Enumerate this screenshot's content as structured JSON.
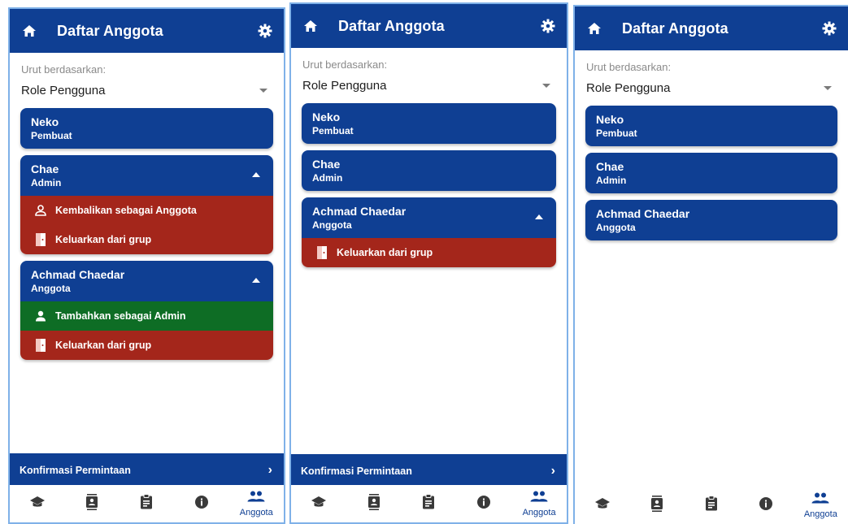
{
  "colors": {
    "primary": "#0f3f93",
    "danger": "#a4261b",
    "success": "#0e6d25"
  },
  "appbar": {
    "title": "Daftar Anggota",
    "home_icon": "home-icon",
    "settings_icon": "gear-icon"
  },
  "sort": {
    "label": "Urut berdasarkan:",
    "value": "Role Pengguna"
  },
  "actions": {
    "demote": "Kembalikan sebagai Anggota",
    "promote": "Tambahkan sebagai Admin",
    "kick": "Keluarkan dari grup"
  },
  "confirm_bar": {
    "label": "Konfirmasi Permintaan",
    "chevron": "›"
  },
  "nav": {
    "items": [
      {
        "icon": "school-icon"
      },
      {
        "icon": "contact-book-icon"
      },
      {
        "icon": "clipboard-icon"
      },
      {
        "icon": "info-icon"
      },
      {
        "icon": "group-icon",
        "label": "Anggota"
      }
    ]
  },
  "screens": [
    {
      "members": [
        {
          "name": "Neko",
          "role": "Pembuat"
        },
        {
          "name": "Chae",
          "role": "Admin"
        },
        {
          "name": "Achmad Chaedar",
          "role": "Anggota"
        }
      ]
    },
    {
      "members": [
        {
          "name": "Neko",
          "role": "Pembuat"
        },
        {
          "name": "Chae",
          "role": "Admin"
        },
        {
          "name": "Achmad Chaedar",
          "role": "Anggota"
        }
      ]
    },
    {
      "members": [
        {
          "name": "Neko",
          "role": "Pembuat"
        },
        {
          "name": "Chae",
          "role": "Admin"
        },
        {
          "name": "Achmad Chaedar",
          "role": "Anggota"
        }
      ]
    }
  ]
}
